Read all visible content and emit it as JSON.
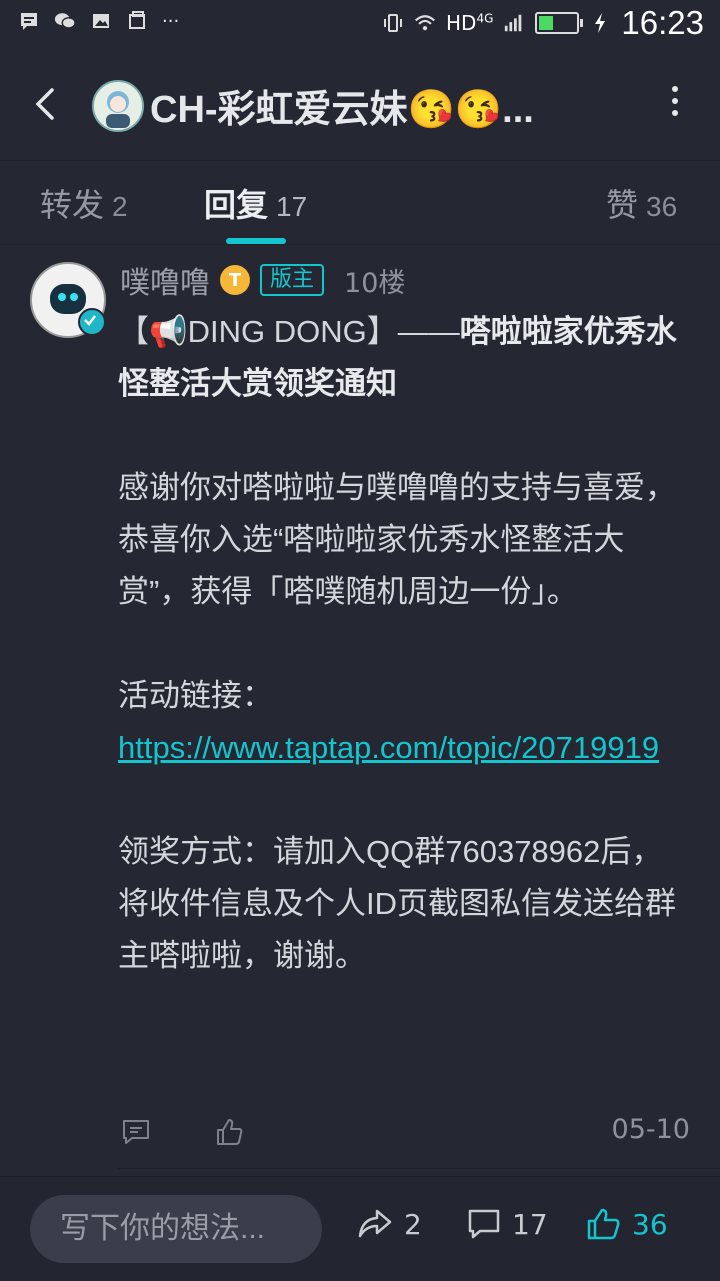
{
  "status_bar": {
    "network": "HD",
    "network_gen": "4G",
    "time": "16:23"
  },
  "header": {
    "title": "CH-彩虹爱云妹😘😘..."
  },
  "tabs": [
    {
      "label": "转发",
      "count": "2"
    },
    {
      "label": "回复",
      "count": "17"
    },
    {
      "label": "赞",
      "count": "36"
    }
  ],
  "post": {
    "author": "噗噜噜",
    "level_badge": "T",
    "role_badge": "版主",
    "floor": "10楼",
    "title_prefix": "【📢DING DONG】——",
    "title_bold": "嗒啦啦家优秀水怪整活大赏领奖通知",
    "para1": "感谢你对嗒啦啦与噗噜噜的支持与喜爱，恭喜你入选“嗒啦啦家优秀水怪整活大赏”，获得「嗒噗随机周边一份」。",
    "link_label": "活动链接：",
    "link_url": "https://www.taptap.com/topic/20719919",
    "para3": "领奖方式：请加入QQ群760378962后，将收件信息及个人ID页截图私信发送给群主嗒啦啦，谢谢。",
    "date": "05-10"
  },
  "bottom_bar": {
    "input_placeholder": "写下你的想法...",
    "share_count": "2",
    "comment_count": "17",
    "like_count": "36"
  },
  "colors": {
    "accent": "#15c5ce",
    "background": "#252733"
  }
}
